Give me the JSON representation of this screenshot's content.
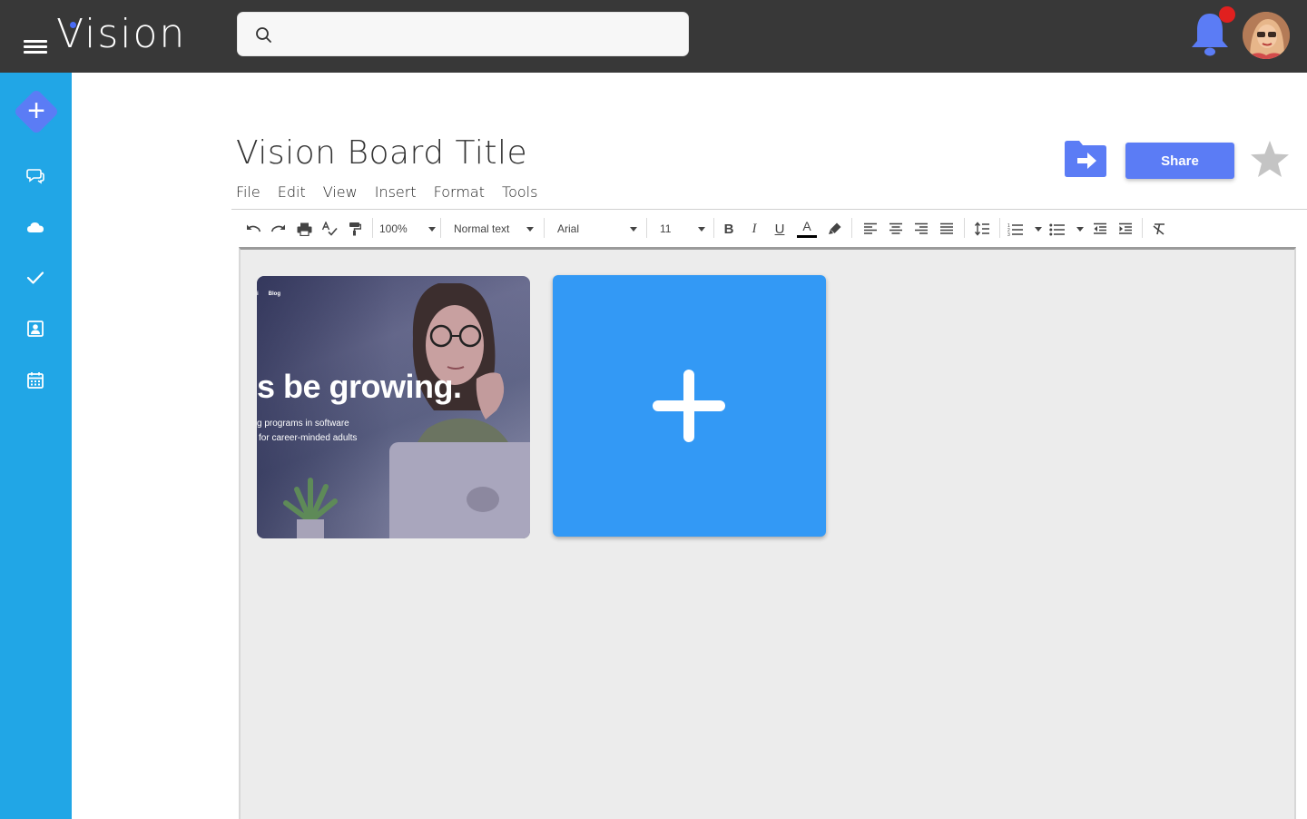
{
  "app": {
    "logo": "Vision"
  },
  "search": {
    "placeholder": "",
    "value": ""
  },
  "colors": {
    "topbar": "#383838",
    "sidebar": "#21a6e6",
    "accent": "#5b7cf5",
    "add_card": "#3399f5",
    "badge": "#e0201f",
    "bell": "#5b7cf5"
  },
  "sidebar": {
    "items": [
      {
        "icon": "plus-icon",
        "label": ""
      },
      {
        "icon": "chat-icon",
        "label": ""
      },
      {
        "icon": "cloud-icon",
        "label": ""
      },
      {
        "icon": "check-icon",
        "label": ""
      },
      {
        "icon": "contact-card-icon",
        "label": ""
      },
      {
        "icon": "calendar-icon",
        "label": ""
      }
    ]
  },
  "document": {
    "title": "Vision Board Title",
    "menu": [
      "File",
      "Edit",
      "View",
      "Insert",
      "Format",
      "Tools"
    ],
    "share_label": "Share"
  },
  "toolbar": {
    "zoom": "100%",
    "style": "Normal text",
    "font": "Arial",
    "size": "11",
    "bold": "B",
    "italic": "I",
    "underline": "U",
    "text_color": "A"
  },
  "board": {
    "image_card": {
      "nav": [
        "i",
        "Blog"
      ],
      "headline": "s be growing.",
      "sub_line_1": "g programs in software",
      "sub_line_2": "for career-minded adults"
    }
  }
}
